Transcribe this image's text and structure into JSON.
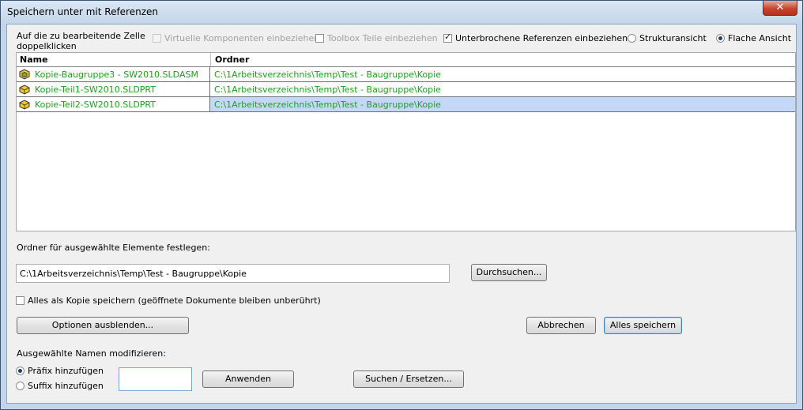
{
  "window": {
    "title": "Speichern unter mit Referenzen",
    "close_label": "✕"
  },
  "top": {
    "hint": "Auf die zu bearbeitende Zelle doppelklicken",
    "virtual_label": "Virtuelle Komponenten einbeziehen",
    "toolbox_label": "Toolbox Teile einbeziehen",
    "broken_label": "Unterbrochene Referenzen einbeziehen",
    "tree_label": "Strukturansicht",
    "flat_label": "Flache Ansicht"
  },
  "table": {
    "col_name": "Name",
    "col_folder": "Ordner",
    "rows": [
      {
        "name": "Kopie-Baugruppe3 - SW2010.SLDASM",
        "folder": "C:\\1Arbeitsverzeichnis\\Temp\\Test - Baugruppe\\Kopie",
        "icon": "assembly-icon"
      },
      {
        "name": "Kopie-Teil1-SW2010.SLDPRT",
        "folder": "C:\\1Arbeitsverzeichnis\\Temp\\Test - Baugruppe\\Kopie",
        "icon": "part-icon"
      },
      {
        "name": "Kopie-Teil2-SW2010.SLDPRT",
        "folder": "C:\\1Arbeitsverzeichnis\\Temp\\Test - Baugruppe\\Kopie",
        "icon": "part-icon"
      }
    ]
  },
  "folder": {
    "label": "Ordner für ausgewählte Elemente festlegen:",
    "value": "C:\\1Arbeitsverzeichnis\\Temp\\Test - Baugruppe\\Kopie",
    "browse_label": "Durchsuchen..."
  },
  "copy_label": "Alles als Kopie speichern (geöffnete Dokumente bleiben unberührt)",
  "buttons": {
    "options": "Optionen ausblenden...",
    "cancel": "Abbrechen",
    "save_all": "Alles speichern",
    "apply": "Anwenden",
    "search_replace": "Suchen / Ersetzen..."
  },
  "modify": {
    "label": "Ausgewählte Namen modifizieren:",
    "prefix_label": "Präfix hinzufügen",
    "suffix_label": "Suffix hinzufügen",
    "text_value": ""
  }
}
